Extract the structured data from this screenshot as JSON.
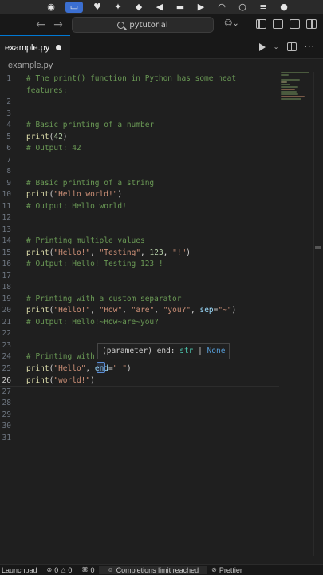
{
  "titlebar": {
    "command_center_label": "pytutorial",
    "back_icon": "arrow-left-icon",
    "forward_icon": "arrow-right-icon"
  },
  "tabs": [
    {
      "label": "example.py",
      "dirty": true
    }
  ],
  "breadcrumb": {
    "label": "example.py"
  },
  "editor": {
    "lines": [
      {
        "n": "1",
        "tokens": [
          {
            "t": "# The print() function in Python has some neat",
            "c": "comment"
          }
        ]
      },
      {
        "n": "",
        "tokens": [
          {
            "t": "features:",
            "c": "comment"
          }
        ]
      },
      {
        "n": "2",
        "tokens": []
      },
      {
        "n": "3",
        "tokens": []
      },
      {
        "n": "4",
        "tokens": [
          {
            "t": "# Basic printing of a number",
            "c": "comment"
          }
        ]
      },
      {
        "n": "5",
        "tokens": [
          {
            "t": "print",
            "c": "fn"
          },
          {
            "t": "(",
            "c": "op"
          },
          {
            "t": "42",
            "c": "num"
          },
          {
            "t": ")",
            "c": "op"
          }
        ]
      },
      {
        "n": "6",
        "tokens": [
          {
            "t": "# Output: 42",
            "c": "comment"
          }
        ]
      },
      {
        "n": "7",
        "tokens": []
      },
      {
        "n": "8",
        "tokens": []
      },
      {
        "n": "9",
        "tokens": [
          {
            "t": "# Basic printing of a string",
            "c": "comment"
          }
        ]
      },
      {
        "n": "10",
        "tokens": [
          {
            "t": "print",
            "c": "fn"
          },
          {
            "t": "(",
            "c": "op"
          },
          {
            "t": "\"Hello world!\"",
            "c": "str"
          },
          {
            "t": ")",
            "c": "op"
          }
        ]
      },
      {
        "n": "11",
        "tokens": [
          {
            "t": "# Output: Hello world!",
            "c": "comment"
          }
        ]
      },
      {
        "n": "12",
        "tokens": []
      },
      {
        "n": "13",
        "tokens": []
      },
      {
        "n": "14",
        "tokens": [
          {
            "t": "# Printing multiple values",
            "c": "comment"
          }
        ]
      },
      {
        "n": "15",
        "tokens": [
          {
            "t": "print",
            "c": "fn"
          },
          {
            "t": "(",
            "c": "op"
          },
          {
            "t": "\"Hello!\"",
            "c": "str"
          },
          {
            "t": ", ",
            "c": "op"
          },
          {
            "t": "\"Testing\"",
            "c": "str"
          },
          {
            "t": ", ",
            "c": "op"
          },
          {
            "t": "123",
            "c": "num"
          },
          {
            "t": ", ",
            "c": "op"
          },
          {
            "t": "\"!\"",
            "c": "str"
          },
          {
            "t": ")",
            "c": "op"
          }
        ]
      },
      {
        "n": "16",
        "tokens": [
          {
            "t": "# Output: Hello! Testing 123 !",
            "c": "comment"
          }
        ]
      },
      {
        "n": "17",
        "tokens": []
      },
      {
        "n": "18",
        "tokens": []
      },
      {
        "n": "19",
        "tokens": [
          {
            "t": "# Printing with a custom separator",
            "c": "comment"
          }
        ]
      },
      {
        "n": "20",
        "tokens": [
          {
            "t": "print",
            "c": "fn"
          },
          {
            "t": "(",
            "c": "op"
          },
          {
            "t": "\"Hello!\"",
            "c": "str"
          },
          {
            "t": ", ",
            "c": "op"
          },
          {
            "t": "\"How\"",
            "c": "str"
          },
          {
            "t": ", ",
            "c": "op"
          },
          {
            "t": "\"are\"",
            "c": "str"
          },
          {
            "t": ", ",
            "c": "op"
          },
          {
            "t": "\"you?\"",
            "c": "str"
          },
          {
            "t": ", ",
            "c": "op"
          },
          {
            "t": "sep",
            "c": "kw"
          },
          {
            "t": "=",
            "c": "op"
          },
          {
            "t": "\"~\"",
            "c": "str"
          },
          {
            "t": ")",
            "c": "op"
          }
        ]
      },
      {
        "n": "21",
        "tokens": [
          {
            "t": "# Output: Hello!~How~are~you?",
            "c": "comment"
          }
        ]
      },
      {
        "n": "22",
        "tokens": []
      },
      {
        "n": "23",
        "tokens": []
      },
      {
        "n": "24",
        "tokens": [
          {
            "t": "# Printing with",
            "c": "comment"
          }
        ]
      },
      {
        "n": "25",
        "tokens": [
          {
            "t": "print",
            "c": "fn"
          },
          {
            "t": "(",
            "c": "op"
          },
          {
            "t": "\"Hello\"",
            "c": "str"
          },
          {
            "t": ", ",
            "c": "op"
          },
          {
            "t": "end",
            "c": "kw"
          },
          {
            "t": "=",
            "c": "op"
          },
          {
            "t": "\" \"",
            "c": "str"
          },
          {
            "t": ")",
            "c": "op"
          }
        ]
      },
      {
        "n": "26",
        "tokens": [
          {
            "t": "print",
            "c": "fn"
          },
          {
            "t": "(",
            "c": "op"
          },
          {
            "t": "\"world!\"",
            "c": "str"
          },
          {
            "t": ")",
            "c": "op"
          }
        ],
        "current": true
      },
      {
        "n": "27",
        "tokens": []
      },
      {
        "n": "28",
        "tokens": []
      },
      {
        "n": "29",
        "tokens": []
      },
      {
        "n": "30",
        "tokens": []
      },
      {
        "n": "31",
        "tokens": []
      }
    ]
  },
  "tooltip": {
    "prefix": "(parameter) end: ",
    "type": "str",
    "sep": " | ",
    "none": "None"
  },
  "statusbar": {
    "launchpad": "Launchpad",
    "problems": "0",
    "warnings": "0",
    "ports": "0",
    "completions": "Completions limit reached",
    "prettier": "Prettier"
  },
  "colors": {
    "accent": "#0078d4",
    "comment": "#6a9955",
    "function": "#dcdcaa",
    "string": "#ce9178",
    "number": "#b5cea8",
    "keyword": "#9cdcfe"
  }
}
